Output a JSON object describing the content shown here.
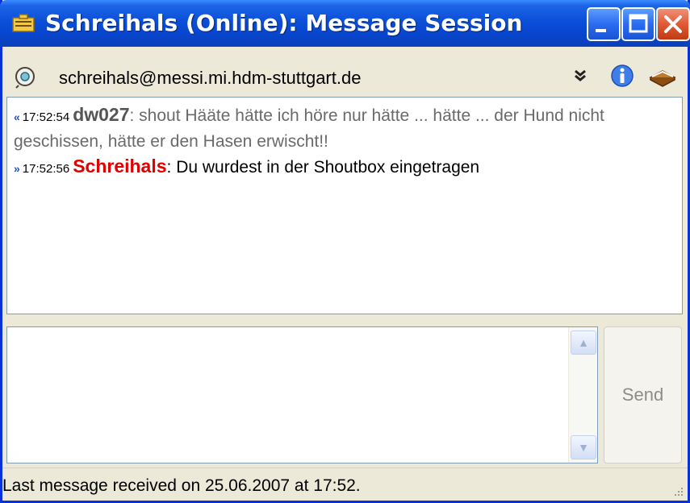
{
  "window": {
    "title": "Schreihals (Online): Message Session"
  },
  "toolbar": {
    "contact": "schreihals@messi.mi.hdm-stuttgart.de",
    "icons": [
      "dropdown-icon",
      "info-icon",
      "history-book-icon"
    ]
  },
  "messages": [
    {
      "direction": "incoming",
      "time": "17:52:54",
      "nick": "dw027",
      "text": ": shout Hääte hätte ich höre nur hätte ... hätte ... der Hund nicht geschissen, hätte er den Hasen erwischt!!"
    },
    {
      "direction": "outgoing",
      "time": "17:52:56",
      "nick": "Schreihals",
      "text": ": Du wurdest in der Shoutbox eingetragen"
    }
  ],
  "input": {
    "value": ""
  },
  "send_label": "Send",
  "status": "Last message received on 25.06.2007 at 17:52.",
  "colors": {
    "titlebar": "#0a4fd8",
    "outgoing_nick": "#e00000",
    "incoming_nick": "#555555"
  }
}
